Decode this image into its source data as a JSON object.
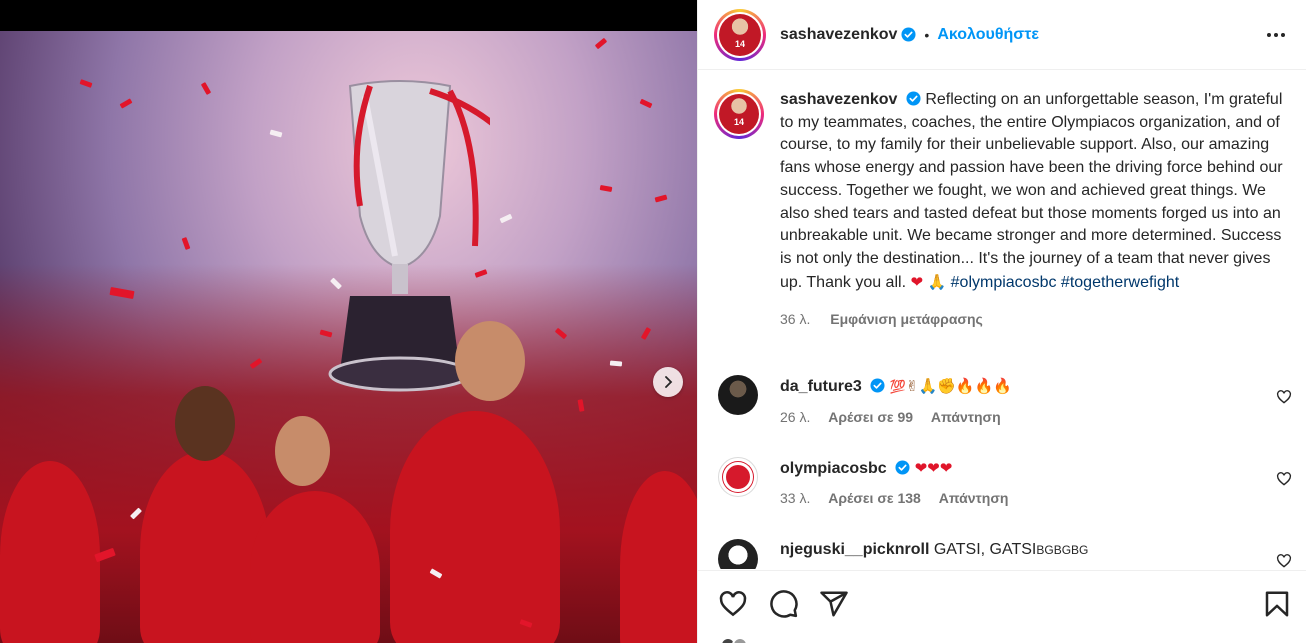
{
  "post": {
    "media_alt": "Olympiacos players celebrating with trophy",
    "next_icon": "chevron-right-icon"
  },
  "header": {
    "username": "sashavezenkov",
    "separator": "•",
    "follow_label": "Ακολουθήστε",
    "more_icon": "more-horizontal-icon"
  },
  "caption": {
    "username": "sashavezenkov",
    "text": "Reflecting on an unforgettable season, I'm grateful to my teammates, coaches, the entire Olympiacos organization, and of course, to my family for their unbelievable support. Also, our amazing fans whose energy and passion have been the driving force behind our success. Together we fought, we won and achieved great things. We also shed tears and tasted defeat but those moments forged us into an unbreakable unit. We became stronger and more determined. Success is not only the destination... It's the journey of a team that never gives up. Thank you all.",
    "emojis": "❤ 🙏",
    "hashtags": [
      "#olympiacosbc",
      "#togetherwefight"
    ],
    "time": "36 λ.",
    "translation_label": "Εμφάνιση μετάφρασης"
  },
  "comments": [
    {
      "username": "da_future3",
      "verified": true,
      "text": "💯✌🙏✊🔥🔥🔥",
      "time": "26 λ.",
      "likes": "Αρέσει σε 99",
      "reply": "Απάντηση"
    },
    {
      "username": "olympiacosbc",
      "verified": true,
      "text": "❤❤❤",
      "time": "33 λ.",
      "likes": "Αρέσει σε 138",
      "reply": "Απάντηση"
    },
    {
      "username": "njeguski__picknroll",
      "verified": false,
      "text": "GATSI, GATSI",
      "flags": "BGBGBG"
    }
  ],
  "actions": {
    "like_icon": "heart-icon",
    "comment_icon": "comment-icon",
    "share_icon": "send-icon",
    "save_icon": "bookmark-icon"
  },
  "colors": {
    "accent": "#0095f6",
    "hashtag": "#00376b",
    "muted": "#737373",
    "text": "#262626",
    "border": "#efefef"
  }
}
